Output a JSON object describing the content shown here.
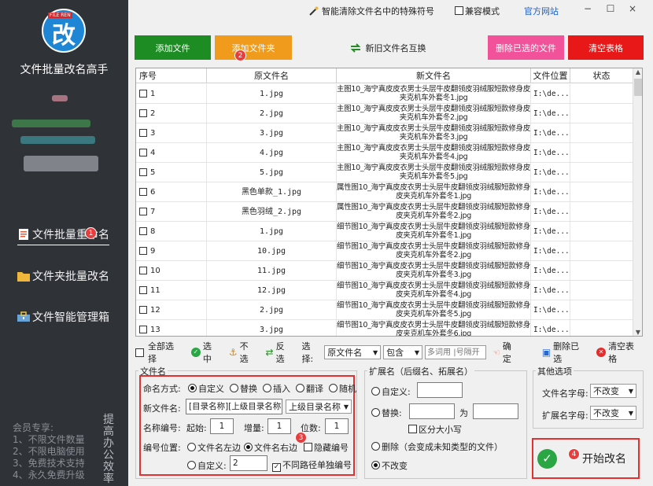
{
  "app": {
    "title": "文件批量改名高手",
    "logo_tag": "FILE REN",
    "logo_char": "改"
  },
  "sidebar": {
    "items": [
      {
        "label": "文件批量重命名"
      },
      {
        "label": "文件夹批量改名"
      },
      {
        "label": "文件智能管理箱"
      }
    ],
    "member": {
      "title": "会员专享:",
      "lines": [
        "1、不限文件数量",
        "2、不限电脑使用",
        "3、免费技术支持",
        "4、永久免费升级"
      ]
    },
    "slogan": "提高办公效率"
  },
  "topbar": {
    "special_chars": "智能清除文件名中的特殊符号",
    "compat_mode": "兼容模式",
    "official_site": "官方网站"
  },
  "actions": {
    "add_file": "添加文件",
    "add_folder": "添加文件夹",
    "swap_names": "新旧文件名互换",
    "delete_selected": "删除已选的文件",
    "clear_table": "清空表格"
  },
  "badges": [
    "1",
    "2",
    "3",
    "4"
  ],
  "table": {
    "headers": [
      "序号",
      "原文件名",
      "新文件名",
      "文件位置",
      "状态"
    ],
    "rows": [
      {
        "idx": "1",
        "orig": "1.jpg",
        "new": "主图10_海宁真皮皮衣男士头层牛皮翻领皮羽绒服短款修身皮夹克机车外套冬1.jpg",
        "loc": "I:\\de..."
      },
      {
        "idx": "2",
        "orig": "2.jpg",
        "new": "主图10_海宁真皮皮衣男士头层牛皮翻领皮羽绒服短款修身皮夹克机车外套冬2.jpg",
        "loc": "I:\\de..."
      },
      {
        "idx": "3",
        "orig": "3.jpg",
        "new": "主图10_海宁真皮皮衣男士头层牛皮翻领皮羽绒服短款修身皮夹克机车外套冬3.jpg",
        "loc": "I:\\de..."
      },
      {
        "idx": "4",
        "orig": "4.jpg",
        "new": "主图10_海宁真皮皮衣男士头层牛皮翻领皮羽绒服短款修身皮夹克机车外套冬4.jpg",
        "loc": "I:\\de..."
      },
      {
        "idx": "5",
        "orig": "5.jpg",
        "new": "主图10_海宁真皮皮衣男士头层牛皮翻领皮羽绒服短款修身皮夹克机车外套冬5.jpg",
        "loc": "I:\\de..."
      },
      {
        "idx": "6",
        "orig": "黑色单款_1.jpg",
        "new": "属性图10_海宁真皮皮衣男士头层牛皮翻领皮羽绒服短款修身皮夹克机车外套冬1.jpg",
        "loc": "I:\\de..."
      },
      {
        "idx": "7",
        "orig": "黑色羽绒_2.jpg",
        "new": "属性图10_海宁真皮皮衣男士头层牛皮翻领皮羽绒服短款修身皮夹克机车外套冬2.jpg",
        "loc": "I:\\de..."
      },
      {
        "idx": "8",
        "orig": "1.jpg",
        "new": "细节图10_海宁真皮皮衣男士头层牛皮翻领皮羽绒服短款修身皮夹克机车外套冬1.jpg",
        "loc": "I:\\de..."
      },
      {
        "idx": "9",
        "orig": "10.jpg",
        "new": "细节图10_海宁真皮皮衣男士头层牛皮翻领皮羽绒服短款修身皮夹克机车外套冬2.jpg",
        "loc": "I:\\de..."
      },
      {
        "idx": "10",
        "orig": "11.jpg",
        "new": "细节图10_海宁真皮皮衣男士头层牛皮翻领皮羽绒服短款修身皮夹克机车外套冬3.jpg",
        "loc": "I:\\de..."
      },
      {
        "idx": "11",
        "orig": "12.jpg",
        "new": "细节图10_海宁真皮皮衣男士头层牛皮翻领皮羽绒服短款修身皮夹克机车外套冬4.jpg",
        "loc": "I:\\de..."
      },
      {
        "idx": "12",
        "orig": "2.jpg",
        "new": "细节图10_海宁真皮皮衣男士头层牛皮翻领皮羽绒服短款修身皮夹克机车外套冬5.jpg",
        "loc": "I:\\de..."
      },
      {
        "idx": "13",
        "orig": "3.jpg",
        "new": "细节图10_海宁真皮皮衣男士头层牛皮翻领皮羽绒服短款修身皮夹克机车外套冬6.jpg",
        "loc": "I:\\de..."
      }
    ]
  },
  "toolbar": {
    "select_all": "全部选择",
    "select": "选中",
    "deselect": "不选",
    "invert": "反选",
    "choose_label": "选择:",
    "field_value": "原文件名",
    "match_value": "包含",
    "keyword_placeholder": "多词用 |号隔开",
    "confirm": "确定",
    "delete_selected": "删除已选",
    "clear_table": "清空表格"
  },
  "filename": {
    "title": "文件名",
    "mode_label": "命名方式:",
    "modes": [
      "自定义",
      "替换",
      "插入",
      "翻译",
      "随机"
    ],
    "new_name_label": "新文件名:",
    "new_name_value": "[目录名称][上级目录名称]",
    "new_name_select": "上级目录名称",
    "numbering_label": "名称编号:",
    "start_label": "起始:",
    "start_value": "1",
    "step_label": "增量:",
    "step_value": "1",
    "digits_label": "位数:",
    "digits_value": "1",
    "position_label": "编号位置:",
    "pos_left": "文件名左边",
    "pos_right": "文件名右边",
    "hide_number": "隐藏编号",
    "pos_custom": "自定义:",
    "custom_value": "2",
    "separate_numbering": "不同路径单独编号"
  },
  "extension": {
    "title": "扩展名（后缀名、拓展名）",
    "custom": "自定义:",
    "replace": "替换:",
    "to": "为",
    "case_sensitive": "区分大小写",
    "delete": "删除（会变成未知类型的文件）",
    "unchanged": "不改变"
  },
  "other": {
    "title": "其他选项",
    "name_case_label": "文件名字母:",
    "name_case_value": "不改变",
    "ext_case_label": "扩展名字母:",
    "ext_case_value": "不改变"
  },
  "start_button": "开始改名"
}
